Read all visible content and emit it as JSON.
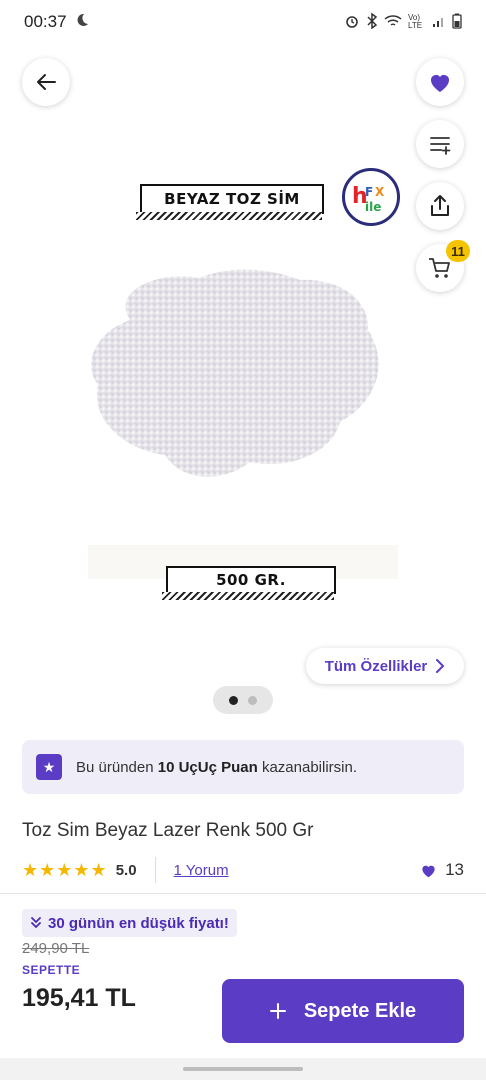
{
  "status": {
    "time": "00:37",
    "icons": [
      "moon-icon",
      "alarm-icon",
      "bluetooth-icon",
      "wifi-icon",
      "volte-icon",
      "signal-icon",
      "battery-icon"
    ],
    "volte": "Vo) LTE"
  },
  "product_image": {
    "top_label": "BEYAZ TOZ SİM",
    "bottom_label": "500 GR.",
    "logo_text": "HOBİ FX"
  },
  "header": {
    "back_icon": "arrow-left-icon",
    "favorite_icon": "heart-icon",
    "list_icon": "list-add-icon",
    "share_icon": "share-icon",
    "cart_icon": "cart-icon",
    "cart_count": "11"
  },
  "specs_button": {
    "label": "Tüm Özellikler"
  },
  "carousel": {
    "count": 2,
    "active": 0
  },
  "points_banner": {
    "prefix": "Bu üründen ",
    "bold": "10 UçUç Puan",
    "suffix": " kazanabilirsin."
  },
  "product": {
    "title": "Toz Sim Beyaz Lazer Renk 500 Gr",
    "rating": "5.0",
    "stars": 5,
    "reviews_label": "1 Yorum",
    "likes": "13"
  },
  "pricing": {
    "low_price_badge": "30 günün en düşük fiyatı!",
    "old_price": "249,90 TL",
    "sepette_label": "SEPETTE",
    "price": "195,41 TL",
    "add_button_label": "Sepete Ekle"
  },
  "colors": {
    "accent": "#5b3cc4",
    "badge": "#f5c400",
    "star": "#f5b800"
  }
}
